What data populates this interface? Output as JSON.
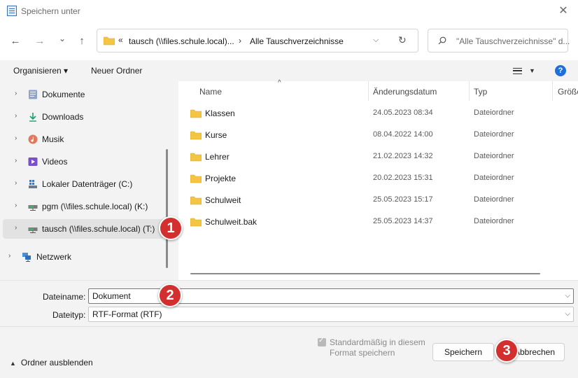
{
  "window": {
    "title": "Speichern unter",
    "close_glyph": "✕"
  },
  "nav": {
    "back_glyph": "←",
    "forward_glyph": "→",
    "recent_glyph": "⌄",
    "up_glyph": "↑",
    "address": {
      "prefix": "«",
      "crumb1": "tausch (\\\\files.schule.local)...",
      "separator": "›",
      "crumb2": "Alle Tauschverzeichnisse",
      "dropdown_glyph": "⌵",
      "refresh_glyph": "↻"
    },
    "search_placeholder": "\"Alle Tauschverzeichnisse\" d..."
  },
  "toolbar": {
    "organize_label": "Organisieren ▾",
    "new_folder_label": "Neuer Ordner",
    "view_dropdown_glyph": "▼",
    "help_label": "?"
  },
  "sidebar": {
    "chevron_glyph": "›",
    "items": [
      {
        "label": "Dokumente",
        "icon": "documents-icon"
      },
      {
        "label": "Downloads",
        "icon": "downloads-icon"
      },
      {
        "label": "Musik",
        "icon": "music-icon"
      },
      {
        "label": "Videos",
        "icon": "videos-icon"
      },
      {
        "label": "Lokaler Datenträger (C:)",
        "icon": "local-disk-icon"
      },
      {
        "label": "pgm (\\\\files.schule.local) (K:)",
        "icon": "network-drive-icon"
      },
      {
        "label": "tausch (\\\\files.schule.local) (T:)",
        "icon": "network-drive-icon",
        "selected": true
      },
      {
        "label": "Netzwerk",
        "icon": "network-icon"
      }
    ]
  },
  "files": {
    "sort_glyph": "^",
    "columns": [
      "Name",
      "Änderungsdatum",
      "Typ",
      "Größe"
    ],
    "rows": [
      {
        "name": "Klassen",
        "date": "24.05.2023 08:34",
        "type": "Dateiordner"
      },
      {
        "name": "Kurse",
        "date": "08.04.2022 14:00",
        "type": "Dateiordner"
      },
      {
        "name": "Lehrer",
        "date": "21.02.2023 14:32",
        "type": "Dateiordner"
      },
      {
        "name": "Projekte",
        "date": "20.02.2023 15:31",
        "type": "Dateiordner"
      },
      {
        "name": "Schulweit",
        "date": "25.05.2023 15:17",
        "type": "Dateiordner"
      },
      {
        "name": "Schulweit.bak",
        "date": "25.05.2023 14:37",
        "type": "Dateiordner"
      }
    ]
  },
  "form": {
    "filename_label": "Dateiname:",
    "filename_value": "Dokument",
    "filetype_label": "Dateityp:",
    "filetype_value": "RTF-Format (RTF)",
    "dropdown_glyph": "⌵",
    "default_format_label": "Standardmäßig in diesem Format speichern",
    "save_label": "Speichern",
    "cancel_label": "Abbrechen",
    "hide_folders_label": "Ordner ausblenden",
    "hide_chevron_glyph": "▲"
  },
  "badges": [
    "1",
    "2",
    "3"
  ],
  "colors": {
    "badge": "#d32f2f",
    "accent": "#1e6fd9",
    "folder": "#f4c542"
  }
}
